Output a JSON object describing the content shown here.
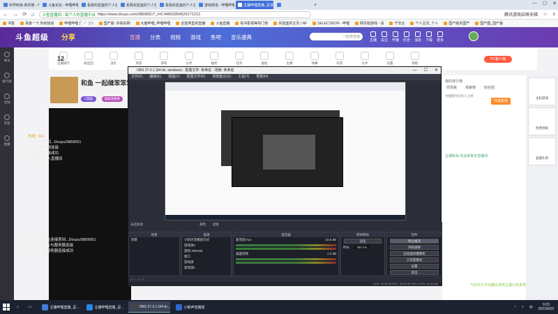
{
  "browser": {
    "tabs": [
      {
        "label": "科学刺身-和问答 - 哔哩哔哩",
        "active": false
      },
      {
        "label": "斗鱼论坛 - 哔哩哔哩_bili",
        "active": false
      },
      {
        "label": "看我实验室的个人空间_哔哩",
        "active": false
      },
      {
        "label": "看我实验室的个人空间_哔哩",
        "active": false
      },
      {
        "label": "看我实验室的个人空间_哔哩",
        "active": false
      },
      {
        "label": "游戏频道 - 哔哩哔哩",
        "active": false
      },
      {
        "label": "主播哔哩直播_足球哔哩直播_斗鱼直播",
        "active": true
      },
      {
        "label": "",
        "active": false
      }
    ],
    "url_secure": "斗鱼直播间 - 每个人的直播平台",
    "url": "https://www.douyu.com/3869051?_t=0.44653354520171213",
    "right_widget": "腾讯游戏召唤天梯",
    "bookmarks": [
      "书签",
      "百度一下,你就知道",
      "哔哩哔哩 (゜-゜)つ",
      "国产最: 好看的网",
      "大脑哔哩_哔哩哔哩",
      "全能类型的直播",
      "斗鱼直播",
      "看书影视等热门体",
      "实验室的主页 | NF",
      "SELECTED中 - 哔哩",
      "网页版游戏 - 请",
      "千年云",
      "个人主页_个人",
      "国产版本国产",
      "国产图_国产最"
    ]
  },
  "douyu": {
    "logo": "斗鱼超级",
    "logo_tag": "分享",
    "nav": [
      "直播",
      "分类",
      "视频",
      "游戏",
      "鱼吧",
      "音乐盛典"
    ],
    "search_placeholder": "一起搜直播",
    "right_items": [
      "主播",
      "关注",
      "开播",
      "历史",
      "消息",
      "下载",
      "更多"
    ],
    "left_sidebar": [
      "关注",
      "排行榜",
      "活动",
      "开放",
      "直播"
    ],
    "toolrow": [
      "主播排行",
      "粉丝团",
      "送礼",
      "贵族",
      "游戏",
      "分享",
      "抽奖",
      "任务",
      "送给",
      "主播",
      "弹幕",
      "好友",
      "分享",
      "设置",
      "帮助"
    ],
    "pc_button": "PC客户端",
    "count": "12",
    "streamer_name": "和鱼 一起缝笨笨笨",
    "badge_level": "V等级",
    "badge_title": "超级观看者",
    "chat_top": [
      {
        "cls": "hot",
        "text": "热度: 304"
      },
      {
        "cls": "",
        "text": "正在连接房间...Douyu/3869051"
      },
      {
        "cls": "",
        "text": "正在与服务器连接"
      },
      {
        "cls": "",
        "text": "与服务器连接成功"
      },
      {
        "cls": "",
        "text": "主播和哥说入直播间"
      }
    ],
    "chat_bottom": [
      {
        "text": "[小提示] 正在连接房间...Douyu/3869051"
      },
      {
        "text": "[小提示] 正在与服务器连接"
      },
      {
        "text": "[小提示] 与服务器连接成功"
      }
    ],
    "right_panel": {
      "title": "我的排行榜",
      "tabs": [
        "周贡献",
        "贡献榜",
        "粉丝团"
      ],
      "sub": "主播暂时没有人上榜",
      "orange_btn": "开通贵族",
      "welcome": "主播和哥 欢迎来到本直播间",
      "bottom": "与往日只平均都会发电主播只有发电"
    },
    "far_right": [
      "主机游戏",
      "免费领取",
      "直播礼物"
    ]
  },
  "obs": {
    "title": "OBS 27.0.1 (64-bit, windows) - 配置文件: 未命名 - 场景: 未命名",
    "menu": [
      "文件(F)",
      "编辑(E)",
      "视图(V)",
      "配置文件(P)",
      "场景集合(S)",
      "工具(T)",
      "帮助(H)"
    ],
    "source_bar": "未选择源",
    "props_btn": "属性",
    "filter_btn": "滤镜",
    "dock_headers": [
      "场景",
      "来源",
      "混音器",
      "转场特效",
      "控件"
    ],
    "scenes": [
      "场景"
    ],
    "sources": [
      "小新声音播放方式",
      "游戏源2",
      "游戏 4RE468",
      "窗口",
      "游戏源",
      "游戏源1"
    ],
    "mixer": [
      {
        "name": "麦克风/Aux",
        "level": "23.5 dB"
      },
      {
        "name": "桌面音频",
        "level": "1.0 dB"
      }
    ],
    "transition": {
      "type": "淡化",
      "duration_label": "时长",
      "duration": "300 ms"
    },
    "controls": [
      "停止推流",
      "开始录制",
      "启动虚拟摄像机",
      "工作室模式",
      "设置",
      "退出"
    ],
    "status": "LIVE: 00:00:00   REC: 00:00:00   CPU: 6.9%, 60.00 fps"
  },
  "taskbar": {
    "items": [
      {
        "label": "主播哔哩直播_足...",
        "color": "#3e7fd8",
        "active": false
      },
      {
        "label": "主播哔哩直播_足...",
        "color": "#2a88e0",
        "active": false
      },
      {
        "label": "OBS 27.0.1 (64-bi...",
        "color": "#444",
        "active": true
      },
      {
        "label": "小新声音播放",
        "color": "#2d6ad0",
        "active": false
      }
    ],
    "time": "9:23",
    "date": "2021/6/23"
  }
}
